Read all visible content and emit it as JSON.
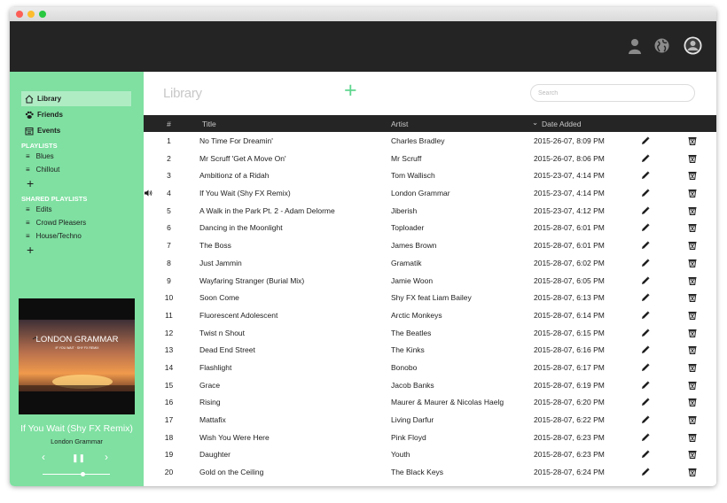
{
  "sidebar": {
    "nav": [
      {
        "label": "Library",
        "icon": "home-icon",
        "active": true
      },
      {
        "label": "Friends",
        "icon": "paw-icon",
        "active": false
      },
      {
        "label": "Events",
        "icon": "calendar-icon",
        "active": false
      }
    ],
    "playlists_heading": "PLAYLISTS",
    "playlists": [
      "Blues",
      "Chillout"
    ],
    "shared_heading": "SHARED PLAYLISTS",
    "shared_playlists": [
      "Edits",
      "Crowd Pleasers",
      "House/Techno"
    ],
    "add_symbol": "+"
  },
  "cover": {
    "artist_text": "LONDON GRAMMAR",
    "sub_text": "IF YOU WAIT · SHY FX REMIX"
  },
  "player": {
    "title": "If You Wait (Shy FX Remix)",
    "artist": "London Grammar",
    "prev_symbol": "‹",
    "pause_symbol": "❚❚",
    "next_symbol": "›",
    "progress_fraction": 0.6
  },
  "main": {
    "title": "Library",
    "add_symbol": "+",
    "search_placeholder": "Search"
  },
  "table": {
    "headers": {
      "num": "#",
      "title": "Title",
      "artist": "Artist",
      "date": "Date Added",
      "sort_symbol": "⌄"
    },
    "playing_index": 3,
    "rows": [
      {
        "num": "1",
        "title": "No Time For Dreamin'",
        "artist": "Charles Bradley",
        "date": "2015-26-07, 8:09 PM"
      },
      {
        "num": "2",
        "title": "Mr Scruff 'Get A Move On'",
        "artist": "Mr Scruff",
        "date": "2015-26-07, 8:06 PM"
      },
      {
        "num": "3",
        "title": "Ambitionz of a Ridah",
        "artist": "Tom Wallisch",
        "date": "2015-23-07, 4:14 PM"
      },
      {
        "num": "4",
        "title": "If You Wait (Shy FX Remix)",
        "artist": "London Grammar",
        "date": "2015-23-07, 4:14 PM"
      },
      {
        "num": "5",
        "title": "A Walk in the Park Pt. 2 - Adam Delorme",
        "artist": "Jiberish",
        "date": "2015-23-07, 4:12 PM"
      },
      {
        "num": "6",
        "title": "Dancing in the Moonlight",
        "artist": "Toploader",
        "date": "2015-28-07, 6:01 PM"
      },
      {
        "num": "7",
        "title": "The Boss",
        "artist": "James Brown",
        "date": "2015-28-07, 6:01 PM"
      },
      {
        "num": "8",
        "title": "Just Jammin",
        "artist": "Gramatik",
        "date": "2015-28-07, 6:02 PM"
      },
      {
        "num": "9",
        "title": "Wayfaring Stranger (Burial Mix)",
        "artist": "Jamie Woon",
        "date": "2015-28-07, 6:05 PM"
      },
      {
        "num": "10",
        "title": "Soon Come",
        "artist": "Shy FX feat Liam Bailey",
        "date": "2015-28-07, 6:13 PM"
      },
      {
        "num": "11",
        "title": "Fluorescent Adolescent",
        "artist": "Arctic Monkeys",
        "date": "2015-28-07, 6:14 PM"
      },
      {
        "num": "12",
        "title": "Twist n Shout",
        "artist": "The Beatles",
        "date": "2015-28-07, 6:15 PM"
      },
      {
        "num": "13",
        "title": "Dead End Street",
        "artist": "The Kinks",
        "date": "2015-28-07, 6:16 PM"
      },
      {
        "num": "14",
        "title": "Flashlight",
        "artist": "Bonobo",
        "date": "2015-28-07, 6:17 PM"
      },
      {
        "num": "15",
        "title": "Grace",
        "artist": "Jacob Banks",
        "date": "2015-28-07, 6:19 PM"
      },
      {
        "num": "16",
        "title": "Rising",
        "artist": "Maurer & Maurer & Nicolas Haelg",
        "date": "2015-28-07, 6:20 PM"
      },
      {
        "num": "17",
        "title": "Mattafix",
        "artist": "Living Darfur",
        "date": "2015-28-07, 6:22 PM"
      },
      {
        "num": "18",
        "title": "Wish You Were Here",
        "artist": "Pink Floyd",
        "date": "2015-28-07, 6:23 PM"
      },
      {
        "num": "19",
        "title": "Daughter",
        "artist": "Youth",
        "date": "2015-28-07, 6:23 PM"
      },
      {
        "num": "20",
        "title": "Gold on the Ceiling",
        "artist": "The Black Keys",
        "date": "2015-28-07, 6:24 PM"
      }
    ]
  },
  "colors": {
    "sidebar_bg": "#7fe0a1",
    "accent": "#5fd68e",
    "topbar_bg": "#242424",
    "table_header_bg": "#252525"
  }
}
